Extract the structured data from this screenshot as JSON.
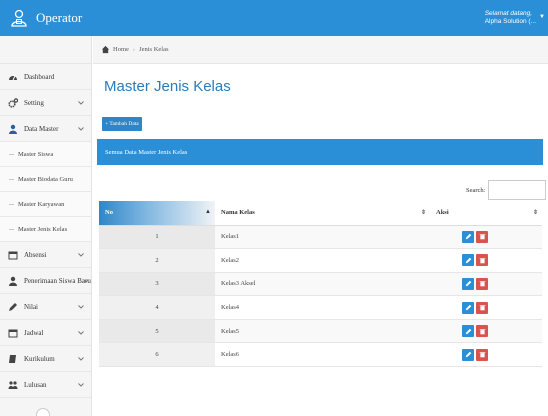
{
  "app": {
    "title": "Operator",
    "user_greeting": "Selamat datang,",
    "user_name": "Alpha Solution (..."
  },
  "sidebar": {
    "items": [
      {
        "label": "Dashboard",
        "icon": "dashboard-icon"
      },
      {
        "label": "Setting",
        "icon": "gears-icon"
      },
      {
        "label": "Data Master",
        "icon": "user-icon"
      },
      {
        "label": "Absensi",
        "icon": "calendar-icon"
      },
      {
        "label": "Penerimaan Siswa Baru",
        "icon": "user-icon"
      },
      {
        "label": "Nilai",
        "icon": "pencil-icon"
      },
      {
        "label": "Jadwal",
        "icon": "calendar-icon"
      },
      {
        "label": "Kurikulum",
        "icon": "book-icon"
      },
      {
        "label": "Lulusan",
        "icon": "graduation-icon"
      }
    ],
    "subitems": [
      {
        "label": "Master Siswa"
      },
      {
        "label": "Master Biodata Guru"
      },
      {
        "label": "Master Karyawan"
      },
      {
        "label": "Master Jenis Kelas"
      }
    ]
  },
  "breadcrumb": {
    "home": "Home",
    "current": "Jenis Kelas"
  },
  "main": {
    "title": "Master Jenis Kelas",
    "add_button": "Tambah Data",
    "panel_title": "Semua Data Master Jenis Kelas",
    "search_label": "Search:",
    "search_value": ""
  },
  "table": {
    "columns": [
      "No",
      "Nama Kelas",
      "Aksi"
    ],
    "rows": [
      {
        "no": "1",
        "nama": "Kelas1"
      },
      {
        "no": "2",
        "nama": "Kelas2"
      },
      {
        "no": "3",
        "nama": "Kelas3 Aksel"
      },
      {
        "no": "4",
        "nama": "Kelas4"
      },
      {
        "no": "5",
        "nama": "Kelas5"
      },
      {
        "no": "6",
        "nama": "Kelas6"
      }
    ]
  },
  "colors": {
    "primary": "#2a8fd6",
    "danger": "#d9534f",
    "title_blue": "#2b7bb9"
  }
}
